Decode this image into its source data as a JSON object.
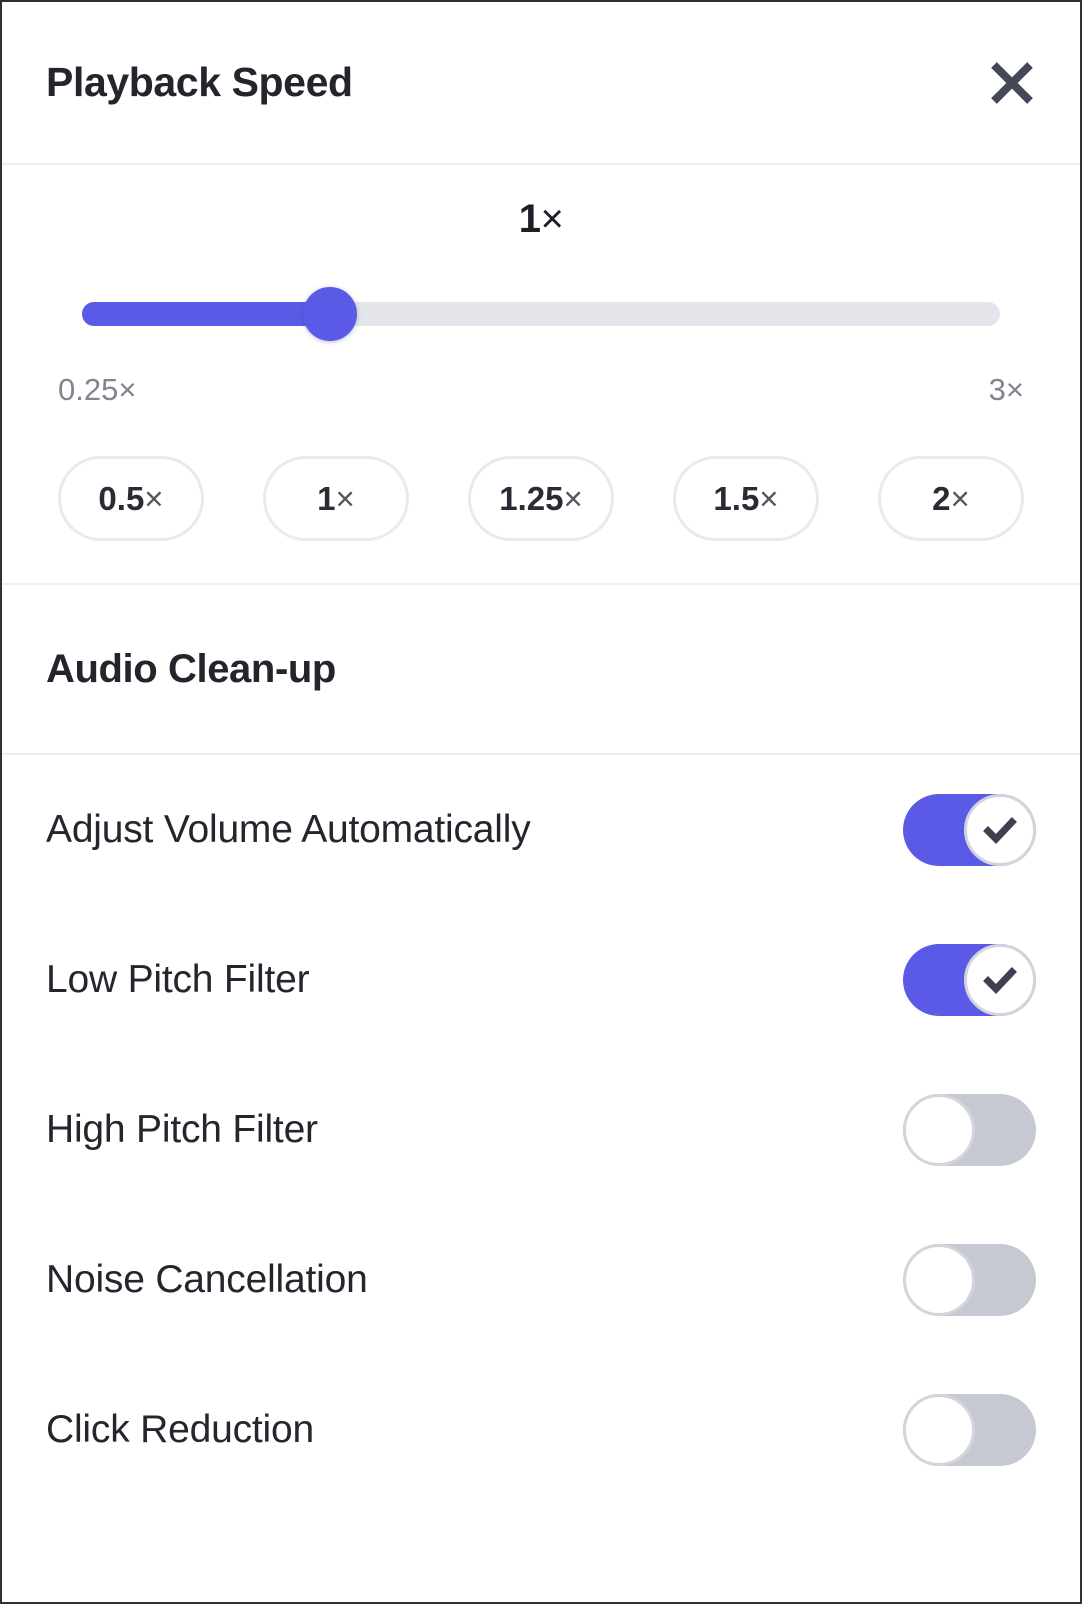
{
  "header": {
    "title": "Playback Speed",
    "close_icon": "close-icon"
  },
  "speed": {
    "current_label": "1",
    "current_unit": "×",
    "min_label": "0.25×",
    "max_label": "3×",
    "min_value": 0.25,
    "max_value": 3,
    "current_value": 1,
    "fill_percent": 27,
    "presets": [
      {
        "value": "0.5",
        "unit": "×"
      },
      {
        "value": "1",
        "unit": "×"
      },
      {
        "value": "1.25",
        "unit": "×"
      },
      {
        "value": "1.5",
        "unit": "×"
      },
      {
        "value": "2",
        "unit": "×"
      }
    ]
  },
  "audio_cleanup": {
    "title": "Audio Clean-up",
    "rows": [
      {
        "label": "Adjust Volume Automatically",
        "on": true
      },
      {
        "label": "Low Pitch Filter",
        "on": true
      },
      {
        "label": "High Pitch Filter",
        "on": false
      },
      {
        "label": "Noise Cancellation",
        "on": false
      },
      {
        "label": "Click Reduction",
        "on": false
      }
    ]
  },
  "colors": {
    "accent": "#5a5ae6",
    "track_off": "#e4e5ea",
    "switch_off": "#c6c8d2",
    "divider": "#eceef1",
    "text_primary": "#24242c",
    "text_muted": "#82858f",
    "check_icon": "#3f4150",
    "close_icon": "#454857"
  }
}
